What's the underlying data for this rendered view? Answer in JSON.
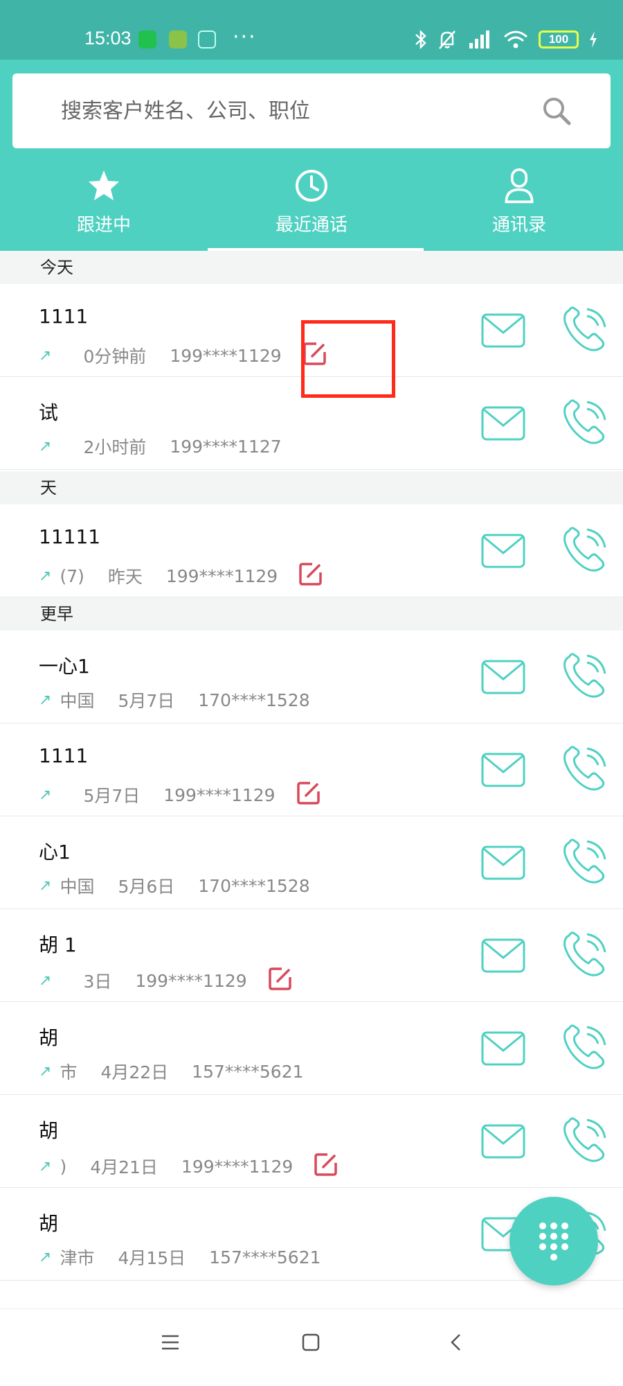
{
  "status_bar": {
    "time": "15:03",
    "more": "···",
    "battery": "100",
    "colors": {
      "bg": "#3fb4a7",
      "battery_outline": "#e6ff4a"
    }
  },
  "search": {
    "placeholder": "搜索客户姓名、公司、职位",
    "icon": "search-icon"
  },
  "tabs": [
    {
      "label": "跟进中",
      "icon": "star-icon",
      "active": false
    },
    {
      "label": "最近通话",
      "icon": "clock-icon",
      "active": true
    },
    {
      "label": "通讯录",
      "icon": "person-icon",
      "active": false
    }
  ],
  "sections": [
    {
      "title": "今天",
      "rows": [
        {
          "name": "1111",
          "count": "",
          "time": "0分钟前",
          "phone": "199****1129",
          "has_note": true
        },
        {
          "name": "试",
          "count": "",
          "time": "2小时前",
          "phone": "199****1127",
          "has_note": false
        }
      ]
    },
    {
      "title": "天",
      "rows": [
        {
          "name": "11111",
          "count": "(7)",
          "time": "昨天",
          "phone": "199****1129",
          "has_note": true
        }
      ]
    },
    {
      "title": "更早",
      "rows": [
        {
          "name": "一心1",
          "count": "中国",
          "time": "5月7日",
          "phone": "170****1528",
          "has_note": false
        },
        {
          "name": "1111",
          "count": "",
          "time": "5月7日",
          "phone": "199****1129",
          "has_note": true
        },
        {
          "name": "心1",
          "count": "中国",
          "time": "5月6日",
          "phone": "170****1528",
          "has_note": false
        },
        {
          "name": "胡 1",
          "count": "",
          "time": "3日",
          "phone": "199****1129",
          "has_note": true
        },
        {
          "name": "胡",
          "count": "市",
          "time": "4月22日",
          "phone": "157****5621",
          "has_note": false
        },
        {
          "name": "胡",
          "count": ")",
          "time": "4月21日",
          "phone": "199****1129",
          "has_note": true
        },
        {
          "name": "胡",
          "count": "津市",
          "time": "4月15日",
          "phone": "157****5621",
          "has_note": false
        }
      ]
    }
  ],
  "icons": {
    "mail": "mail-icon",
    "phone": "phone-icon",
    "note": "edit-note-icon",
    "dialpad": "dialpad-icon"
  },
  "colors": {
    "primary": "#4fd1c2",
    "note_red": "#d9485a",
    "highlight": "#ff2a1a",
    "section_bg": "#f3f5f5"
  }
}
